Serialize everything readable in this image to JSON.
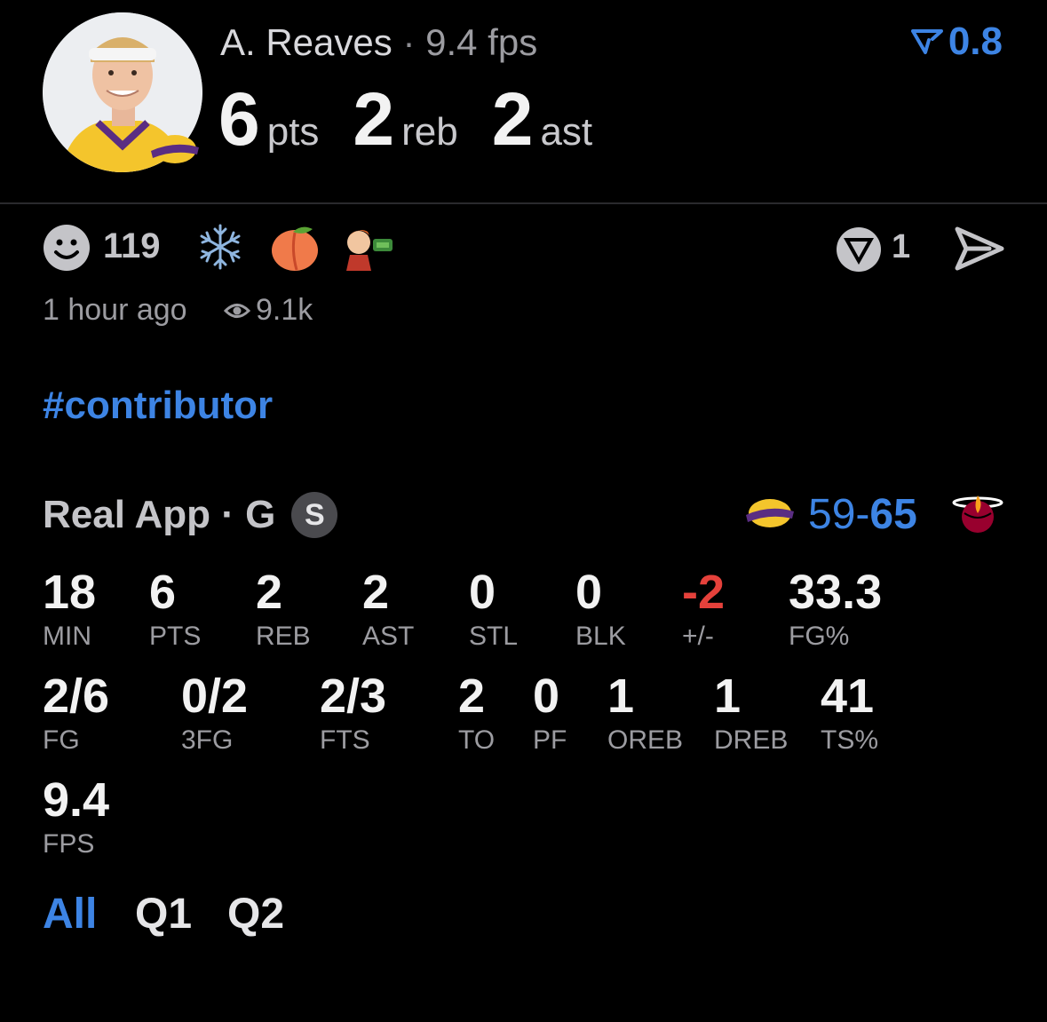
{
  "header": {
    "player_name": "A. Reaves",
    "separator": "·",
    "fps_text": "9.4 fps",
    "rating": "0.8",
    "stats": [
      {
        "value": "6",
        "unit": "pts"
      },
      {
        "value": "2",
        "unit": "reb"
      },
      {
        "value": "2",
        "unit": "ast"
      }
    ]
  },
  "reactions": {
    "count": "119",
    "comment_count": "1",
    "icons": [
      "smile-icon",
      "snowflake-icon",
      "peach-icon",
      "cartoon-money-icon",
      "v-logo-icon",
      "send-icon"
    ]
  },
  "meta": {
    "time": "1 hour ago",
    "views": "9.1k"
  },
  "hashtag": "#contributor",
  "game": {
    "source": "Real App · G",
    "badge": "S",
    "score_left": "59",
    "score_sep": "-",
    "score_right": "65",
    "colors": {
      "accent": "#3d84e4",
      "negative": "#e5413b"
    }
  },
  "stat_rows": [
    [
      {
        "v": "18",
        "l": "MIN"
      },
      {
        "v": "6",
        "l": "PTS"
      },
      {
        "v": "2",
        "l": "REB"
      },
      {
        "v": "2",
        "l": "AST"
      },
      {
        "v": "0",
        "l": "STL"
      },
      {
        "v": "0",
        "l": "BLK"
      },
      {
        "v": "-2",
        "l": "+/-"
      },
      {
        "v": "33.3",
        "l": "FG%"
      }
    ],
    [
      {
        "v": "2/6",
        "l": "FG"
      },
      {
        "v": "0/2",
        "l": "3FG"
      },
      {
        "v": "2/3",
        "l": "FTS"
      },
      {
        "v": "2",
        "l": "TO"
      },
      {
        "v": "0",
        "l": "PF"
      },
      {
        "v": "1",
        "l": "OREB"
      },
      {
        "v": "1",
        "l": "DREB"
      },
      {
        "v": "41",
        "l": "TS%"
      }
    ],
    [
      {
        "v": "9.4",
        "l": "FPS"
      }
    ]
  ],
  "tabs": [
    "All",
    "Q1",
    "Q2"
  ],
  "active_tab": "All"
}
